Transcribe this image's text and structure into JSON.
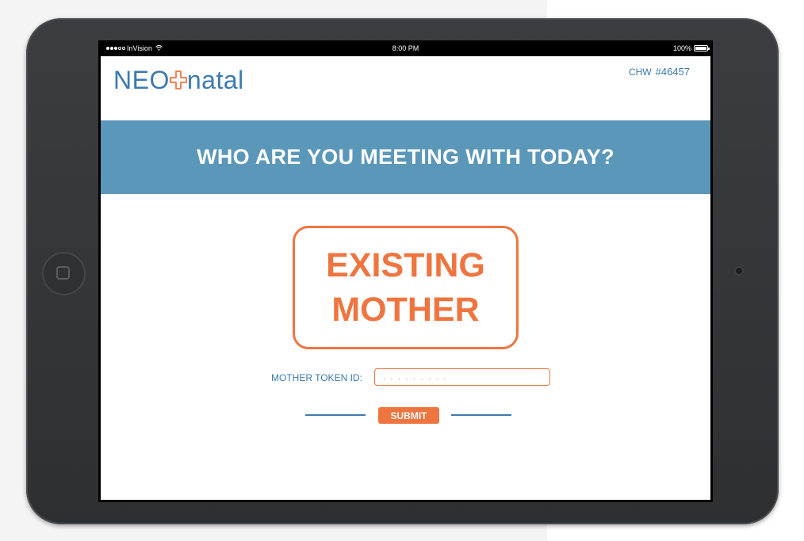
{
  "status_bar": {
    "carrier": "InVision",
    "time": "8:00 PM",
    "battery": "100%",
    "signal_icon": "signal-dots-icon",
    "wifi_icon": "wifi-icon",
    "battery_icon": "battery-icon"
  },
  "header": {
    "logo_left": "NEO",
    "logo_right": "natal",
    "logo_mark_icon": "plus-cross-icon",
    "chw_label": "CHW",
    "chw_number": "#46457"
  },
  "banner": {
    "title": "WHO ARE YOU MEETING WITH TODAY?"
  },
  "choice": {
    "line1": "EXISTING",
    "line2": "MOTHER"
  },
  "token": {
    "label": "MOTHER TOKEN ID:",
    "placeholder": ". . . . . . . . .",
    "value": ""
  },
  "submit": {
    "label": "SUBMIT"
  },
  "colors": {
    "brand_blue": "#3c7ab0",
    "banner_blue": "#5a97b9",
    "accent_orange": "#ef7540"
  }
}
